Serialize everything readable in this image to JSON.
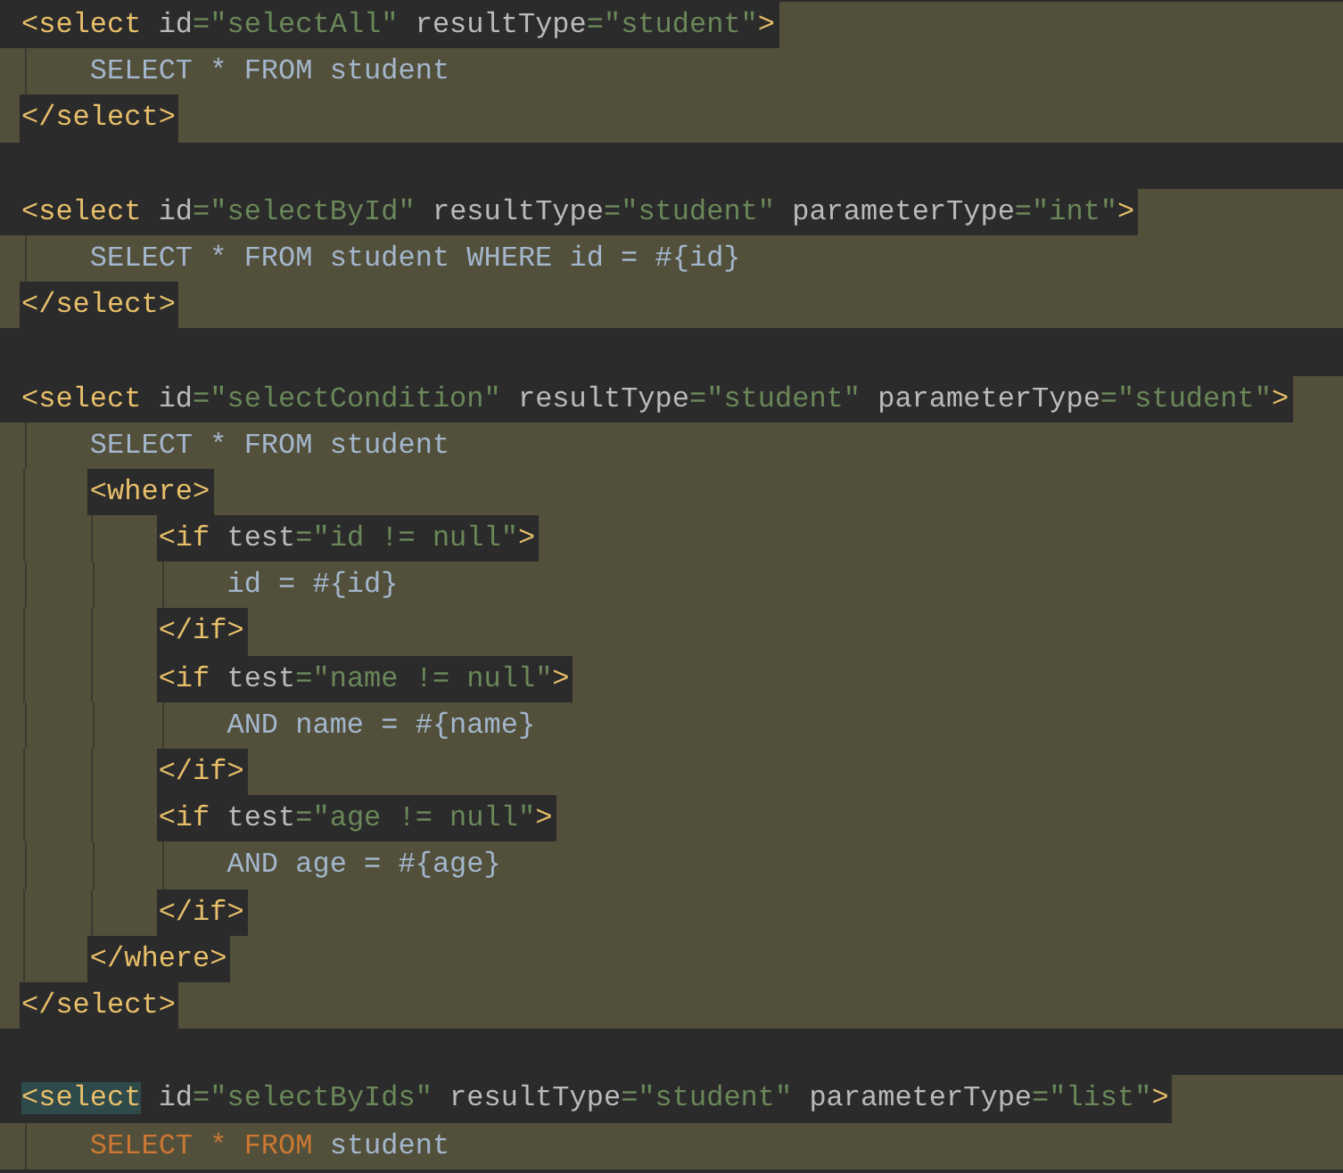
{
  "editor": {
    "lines": [
      {
        "kind": "open",
        "tokens": [
          {
            "kind": "tag",
            "text": "<select",
            "matched": false
          },
          {
            "kind": "attr",
            "text": " id",
            "matched": false
          },
          {
            "kind": "value",
            "text": "=\"selectAll\"",
            "matched": false
          },
          {
            "kind": "attr",
            "text": " resultType",
            "matched": false
          },
          {
            "kind": "value",
            "text": "=\"student\"",
            "matched": false
          },
          {
            "kind": "tag",
            "text": ">",
            "matched": false
          }
        ],
        "children": [
          {
            "kind": "sql",
            "tokens": [
              {
                "kind": "sql",
                "text": "SELECT * FROM student",
                "matched": false
              }
            ]
          }
        ]
      },
      {
        "kind": "tag",
        "tokens": [
          {
            "kind": "tag",
            "text": "</select>",
            "matched": false
          }
        ]
      },
      {
        "kind": "blank"
      },
      {
        "kind": "open",
        "tokens": [
          {
            "kind": "tag",
            "text": "<select",
            "matched": false
          },
          {
            "kind": "attr",
            "text": " id",
            "matched": false
          },
          {
            "kind": "value",
            "text": "=\"selectById\"",
            "matched": false
          },
          {
            "kind": "attr",
            "text": " resultType",
            "matched": false
          },
          {
            "kind": "value",
            "text": "=\"student\"",
            "matched": false
          },
          {
            "kind": "attr",
            "text": " parameterType",
            "matched": false
          },
          {
            "kind": "value",
            "text": "=\"int\"",
            "matched": false
          },
          {
            "kind": "tag",
            "text": ">",
            "matched": false
          }
        ],
        "children": [
          {
            "kind": "sql",
            "tokens": [
              {
                "kind": "sql",
                "text": "SELECT * FROM student WHERE id = #{id}",
                "matched": false
              }
            ]
          }
        ]
      },
      {
        "kind": "tag",
        "tokens": [
          {
            "kind": "tag",
            "text": "</select>",
            "matched": false
          }
        ]
      },
      {
        "kind": "blank"
      },
      {
        "kind": "open",
        "tokens": [
          {
            "kind": "tag",
            "text": "<select",
            "matched": false
          },
          {
            "kind": "attr",
            "text": " id",
            "matched": false
          },
          {
            "kind": "value",
            "text": "=\"selectCondition\"",
            "matched": false
          },
          {
            "kind": "attr",
            "text": " resultType",
            "matched": false
          },
          {
            "kind": "value",
            "text": "=\"student\"",
            "matched": false
          },
          {
            "kind": "attr",
            "text": " parameterType",
            "matched": false
          },
          {
            "kind": "value",
            "text": "=\"student\"",
            "matched": false
          },
          {
            "kind": "tag",
            "text": ">",
            "matched": false
          }
        ],
        "children": [
          {
            "kind": "sql",
            "tokens": [
              {
                "kind": "sql",
                "text": "SELECT * FROM student",
                "matched": false
              }
            ]
          },
          {
            "kind": "tag",
            "tokens": [
              {
                "kind": "tag",
                "text": "<where>",
                "matched": false
              }
            ],
            "children": [
              {
                "kind": "tag",
                "tokens": [
                  {
                    "kind": "tag",
                    "text": "<if",
                    "matched": false
                  },
                  {
                    "kind": "attr",
                    "text": " test",
                    "matched": false
                  },
                  {
                    "kind": "value",
                    "text": "=\"id != null\"",
                    "matched": false
                  },
                  {
                    "kind": "tag",
                    "text": ">",
                    "matched": false
                  }
                ],
                "children": [
                  {
                    "kind": "sql",
                    "tokens": [
                      {
                        "kind": "sql",
                        "text": "id = #{id}",
                        "matched": false
                      }
                    ]
                  }
                ]
              },
              {
                "kind": "tag",
                "tokens": [
                  {
                    "kind": "tag",
                    "text": "</if>",
                    "matched": false
                  }
                ]
              },
              {
                "kind": "tag",
                "tokens": [
                  {
                    "kind": "tag",
                    "text": "<if",
                    "matched": false
                  },
                  {
                    "kind": "attr",
                    "text": " test",
                    "matched": false
                  },
                  {
                    "kind": "value",
                    "text": "=\"name != null\"",
                    "matched": false
                  },
                  {
                    "kind": "tag",
                    "text": ">",
                    "matched": false
                  }
                ],
                "children": [
                  {
                    "kind": "sql",
                    "tokens": [
                      {
                        "kind": "sql",
                        "text": "AND name = #{name}",
                        "matched": false
                      }
                    ]
                  }
                ]
              },
              {
                "kind": "tag",
                "tokens": [
                  {
                    "kind": "tag",
                    "text": "</if>",
                    "matched": false
                  }
                ]
              },
              {
                "kind": "tag",
                "tokens": [
                  {
                    "kind": "tag",
                    "text": "<if",
                    "matched": false
                  },
                  {
                    "kind": "attr",
                    "text": " test",
                    "matched": false
                  },
                  {
                    "kind": "value",
                    "text": "=\"age != null\"",
                    "matched": false
                  },
                  {
                    "kind": "tag",
                    "text": ">",
                    "matched": false
                  }
                ],
                "children": [
                  {
                    "kind": "sql",
                    "tokens": [
                      {
                        "kind": "sql",
                        "text": "AND age = #{age}",
                        "matched": false
                      }
                    ]
                  }
                ]
              },
              {
                "kind": "tag",
                "tokens": [
                  {
                    "kind": "tag",
                    "text": "</if>",
                    "matched": false
                  }
                ]
              }
            ]
          },
          {
            "kind": "tag",
            "tokens": [
              {
                "kind": "tag",
                "text": "</where>",
                "matched": false
              }
            ]
          }
        ]
      },
      {
        "kind": "tag",
        "tokens": [
          {
            "kind": "tag",
            "text": "</select>",
            "matched": false
          }
        ]
      },
      {
        "kind": "blank"
      },
      {
        "kind": "open",
        "tokens": [
          {
            "kind": "tag",
            "text": "<select",
            "matched": true
          },
          {
            "kind": "attr",
            "text": " id",
            "matched": false
          },
          {
            "kind": "value",
            "text": "=\"selectByIds\"",
            "matched": false
          },
          {
            "kind": "attr",
            "text": " resultType",
            "matched": false
          },
          {
            "kind": "value",
            "text": "=\"student\"",
            "matched": false
          },
          {
            "kind": "attr",
            "text": " parameterType",
            "matched": false
          },
          {
            "kind": "value",
            "text": "=\"list\"",
            "matched": false
          },
          {
            "kind": "tag",
            "text": ">",
            "matched": false
          }
        ],
        "children": [
          {
            "kind": "sql",
            "tokens": [
              {
                "kind": "keyword",
                "text": "SELECT ",
                "matched": false
              },
              {
                "kind": "keyword",
                "text": "* ",
                "matched": false
              },
              {
                "kind": "keyword",
                "text": "FROM",
                "matched": false
              },
              {
                "kind": "sql",
                "text": " student",
                "matched": false
              }
            ]
          }
        ]
      }
    ]
  }
}
